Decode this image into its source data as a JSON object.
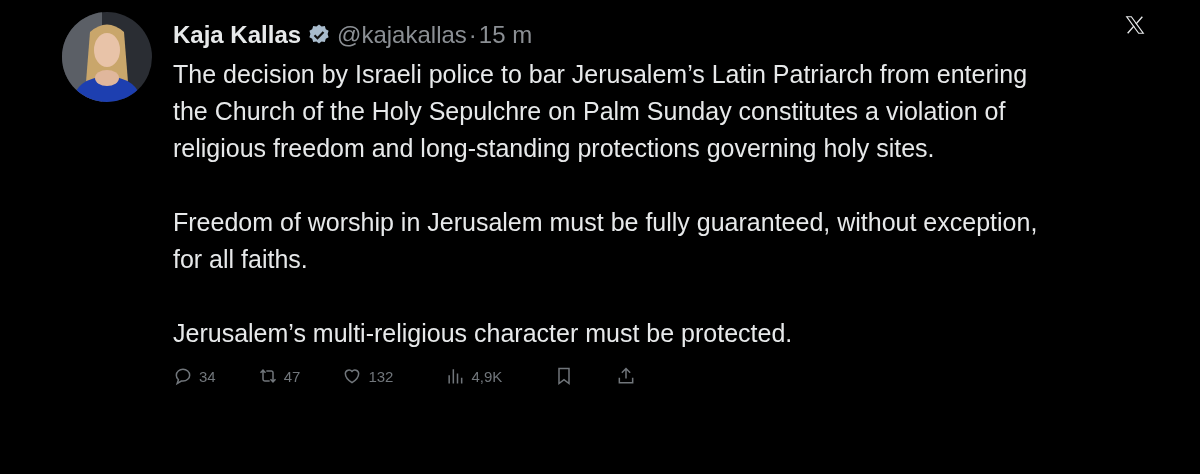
{
  "author": {
    "name": "Kaja Kallas",
    "verified": true,
    "handle": "@kajakallas",
    "separator": "·",
    "time": "15 m"
  },
  "paragraphs": [
    "The decision by Israeli police to bar Jerusalem’s Latin Patriarch from entering the Church of the Holy Sepulchre on Palm Sunday constitutes a violation of religious freedom and long-standing protections governing holy sites.",
    "Freedom of worship in Jerusalem must be fully guaranteed, without exception, for all faiths.",
    "Jerusalem’s multi-religious character must be protected."
  ],
  "actions": [
    {
      "kind": "reply",
      "count": "34"
    },
    {
      "kind": "repost",
      "count": "47"
    },
    {
      "kind": "like",
      "count": "132"
    },
    {
      "kind": "views",
      "count": "4,9K"
    },
    {
      "kind": "bookmark"
    },
    {
      "kind": "share"
    }
  ]
}
